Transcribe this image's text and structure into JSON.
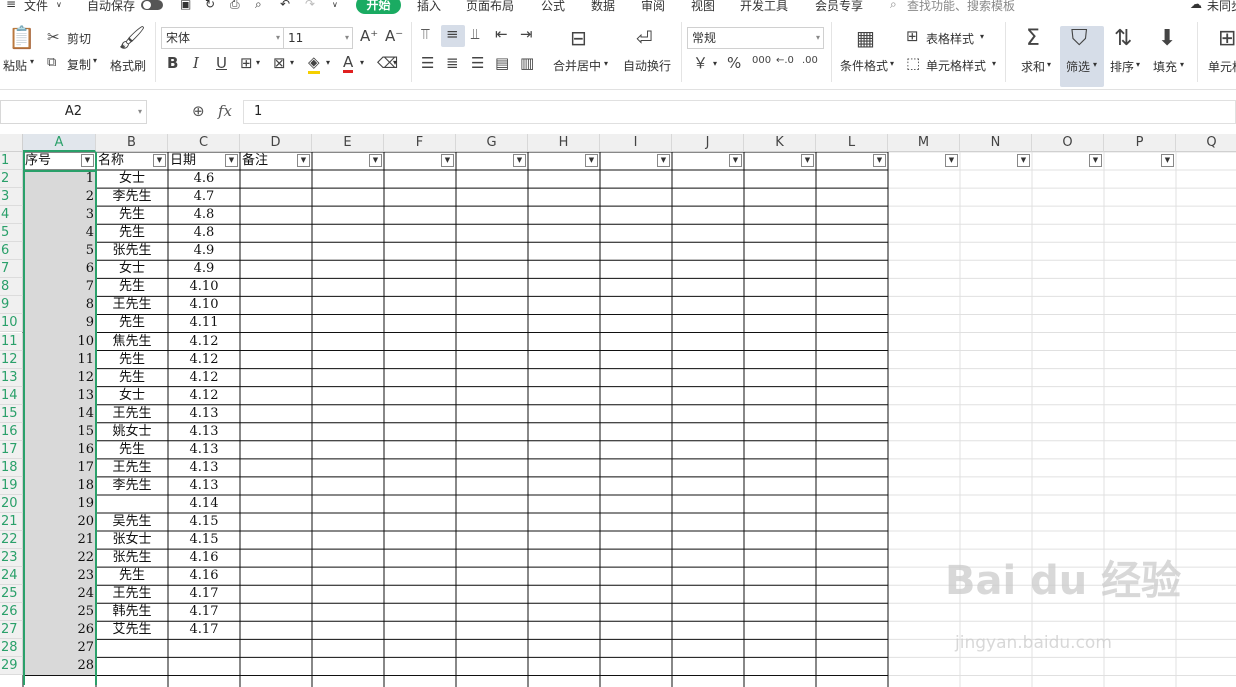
{
  "menu": {
    "file": "文件",
    "autosave": "自动保存",
    "tabs": [
      "开始",
      "插入",
      "页面布局",
      "公式",
      "数据",
      "审阅",
      "视图",
      "开发工具",
      "会员专享"
    ],
    "search_placeholder": "查找功能、搜索模板",
    "sync": "未同步"
  },
  "ribbon": {
    "paste": "粘贴",
    "cut": "剪切",
    "copy": "复制",
    "format_painter": "格式刷",
    "font_name": "宋体",
    "font_size": "11",
    "number_format": "常规",
    "merge_center": "合并居中",
    "wrap_text": "自动换行",
    "conditional_format": "条件格式",
    "table_style": "表格样式",
    "cell_style": "单元格样式",
    "sum": "求和",
    "filter": "筛选",
    "sort": "排序",
    "fill": "填充",
    "cell": "单元格",
    "currency_symbol": "￥",
    "percent_symbol": "%",
    "thousands_symbol": "000",
    "font_color_letter": "A",
    "bold_letter": "B",
    "italic_letter": "I",
    "underline_letter": "U",
    "accent_color": "#1aab62"
  },
  "formula_bar": {
    "name_box": "A2",
    "fx": "fx",
    "value": "1"
  },
  "columns": [
    "A",
    "B",
    "C",
    "D",
    "E",
    "F",
    "G",
    "H",
    "I",
    "J",
    "K",
    "L",
    "M",
    "N",
    "O",
    "P",
    "Q"
  ],
  "headers": [
    "序号",
    "名称",
    "日期",
    "备注"
  ],
  "rows": [
    {
      "a": "1",
      "b": "女士",
      "c": "4.6"
    },
    {
      "a": "2",
      "b": "李先生",
      "c": "4.7"
    },
    {
      "a": "3",
      "b": "先生",
      "c": "4.8"
    },
    {
      "a": "4",
      "b": "先生",
      "c": "4.8"
    },
    {
      "a": "5",
      "b": "张先生",
      "c": "4.9"
    },
    {
      "a": "6",
      "b": "女士",
      "c": "4.9"
    },
    {
      "a": "7",
      "b": "先生",
      "c": "4.10"
    },
    {
      "a": "8",
      "b": "王先生",
      "c": "4.10"
    },
    {
      "a": "9",
      "b": "先生",
      "c": "4.11"
    },
    {
      "a": "10",
      "b": "焦先生",
      "c": "4.12"
    },
    {
      "a": "11",
      "b": "先生",
      "c": "4.12"
    },
    {
      "a": "12",
      "b": "先生",
      "c": "4.12"
    },
    {
      "a": "13",
      "b": "女士",
      "c": "4.12"
    },
    {
      "a": "14",
      "b": "王先生",
      "c": "4.13"
    },
    {
      "a": "15",
      "b": "姚女士",
      "c": "4.13"
    },
    {
      "a": "16",
      "b": "先生",
      "c": "4.13"
    },
    {
      "a": "17",
      "b": "王先生",
      "c": "4.13"
    },
    {
      "a": "18",
      "b": "李先生",
      "c": "4.13"
    },
    {
      "a": "19",
      "b": "",
      "c": "4.14"
    },
    {
      "a": "20",
      "b": "吴先生",
      "c": "4.15"
    },
    {
      "a": "21",
      "b": "张女士",
      "c": "4.15"
    },
    {
      "a": "22",
      "b": "张先生",
      "c": "4.16"
    },
    {
      "a": "23",
      "b": "先生",
      "c": "4.16"
    },
    {
      "a": "24",
      "b": "王先生",
      "c": "4.17"
    },
    {
      "a": "25",
      "b": "韩先生",
      "c": "4.17"
    },
    {
      "a": "26",
      "b": "艾先生",
      "c": "4.17"
    },
    {
      "a": "27",
      "b": "",
      "c": ""
    },
    {
      "a": "28",
      "b": "",
      "c": ""
    }
  ],
  "row_numbers": [
    "1",
    "2",
    "3",
    "4",
    "5",
    "6",
    "7",
    "8",
    "9",
    "10",
    "11",
    "12",
    "13",
    "14",
    "15",
    "16",
    "17",
    "18",
    "19",
    "20",
    "21",
    "22",
    "23",
    "24",
    "25",
    "26",
    "27",
    "28",
    "29"
  ],
  "watermark": {
    "logo": "Bai du 经验",
    "url": "jingyan.baidu.com"
  }
}
